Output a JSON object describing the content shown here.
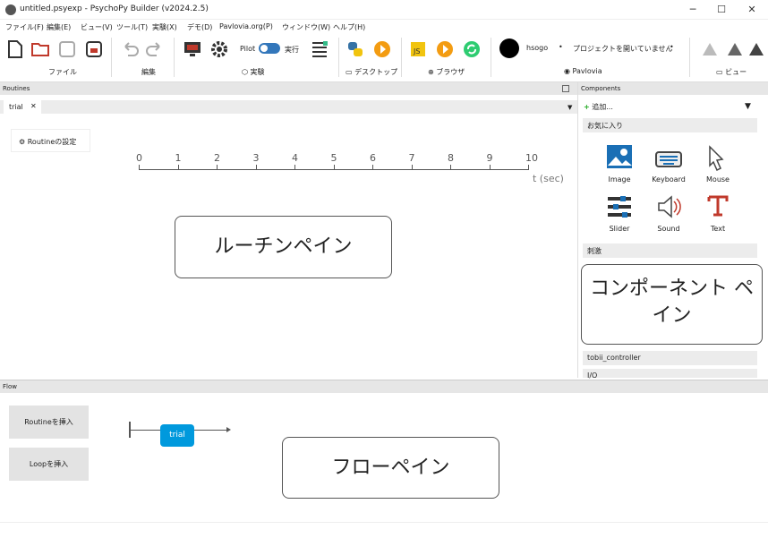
{
  "window": {
    "title": "untitled.psyexp - PsychoPy Builder (v2024.2.5)"
  },
  "menus": [
    "ファイル(F)",
    "編集(E)",
    "ビュー(V)",
    "ツール(T)",
    "実験(X)",
    "デモ(D)",
    "Pavlovia.org(P)",
    "ウィンドウ(W)",
    "ヘルプ(H)"
  ],
  "ribbon": {
    "groups": [
      "ファイル",
      "編集",
      "実験",
      "デスクトップ",
      "ブラウザ",
      "Pavlovia",
      "ビュー"
    ],
    "pilot_label": "Pilot",
    "run_label": "実行",
    "user": "hsogo",
    "project_label": "プロジェクトを開いていません"
  },
  "routines": {
    "header": "Routines",
    "tab": "trial",
    "settings_label": "Routineの設定",
    "ticks": [
      "0",
      "1",
      "2",
      "3",
      "4",
      "5",
      "6",
      "7",
      "8",
      "9",
      "10"
    ],
    "unit_label": "t (sec)",
    "callout": "ルーチンペイン"
  },
  "components": {
    "header": "Components",
    "add_label": "追加...",
    "favorites_label": "お気に入り",
    "items": [
      "Image",
      "Keyboard",
      "Mouse",
      "Slider",
      "Sound",
      "Text"
    ],
    "stimuli_label": "刺激",
    "tobii_label": "tobii_controller",
    "io_label": "I/O",
    "callout": "コンポーネント ペイン"
  },
  "flow": {
    "header": "Flow",
    "insert_routine": "Routineを挿入",
    "insert_loop": "Loopを挿入",
    "trial_label": "trial",
    "callout": "フローペイン"
  },
  "colors": {
    "accent": "#0099dd",
    "callout_border": "#555555",
    "pane_header": "#e6e6e6"
  }
}
